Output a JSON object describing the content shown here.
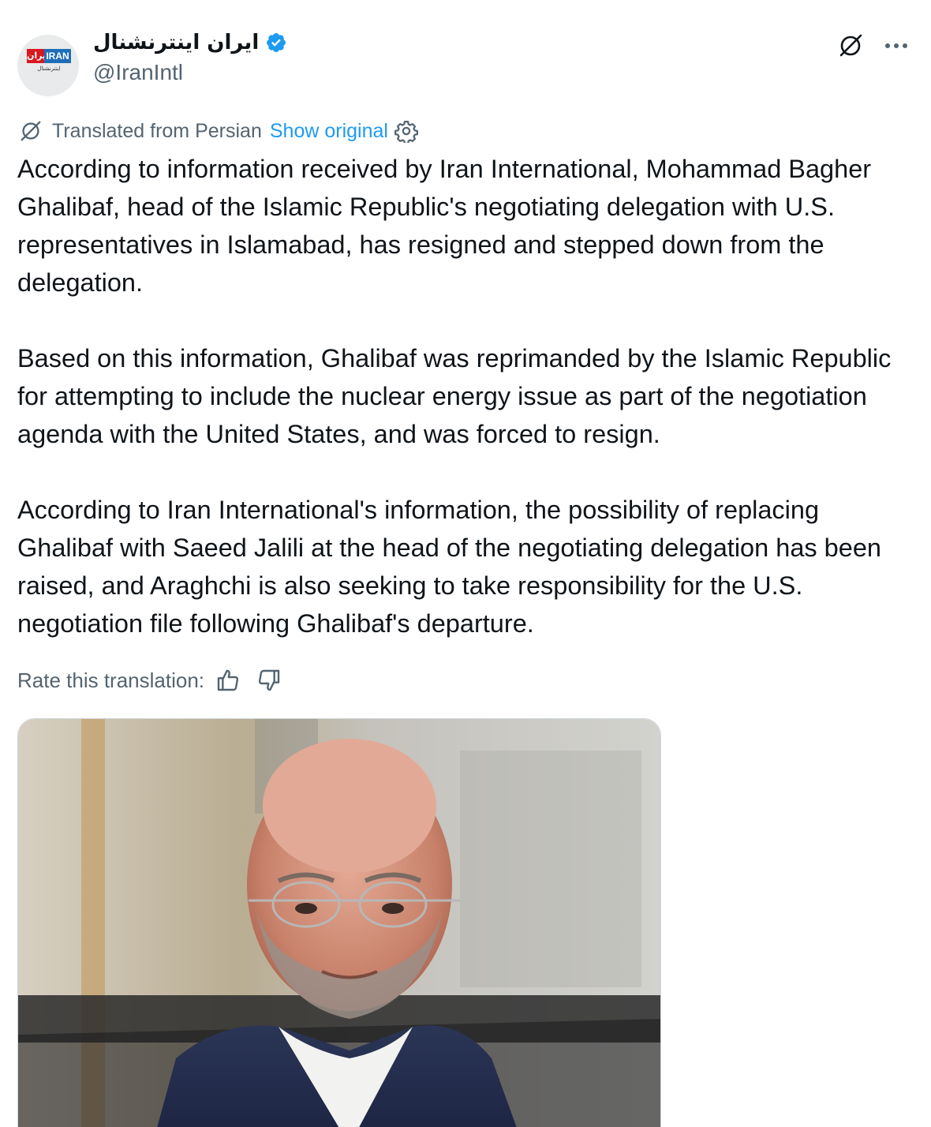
{
  "author": {
    "display_name": "ایران اینترنشنال",
    "handle": "@IranIntl",
    "verified": true,
    "avatar_logo": {
      "red_text": "ایران",
      "blue_text": "IRAN",
      "sub_text": "اینترنشنال"
    }
  },
  "header_icons": [
    "grok-icon",
    "more-icon"
  ],
  "translation": {
    "label": "Translated from Persian",
    "show_original": "Show original",
    "icon": "translate-icon",
    "settings_icon": "gear-icon"
  },
  "tweet": {
    "paragraphs": [
      "According to information received by Iran International, Mohammad Bagher Ghalibaf, head of the Islamic Republic's negotiating delegation with U.S. representatives in Islamabad, has resigned and stepped down from the delegation.",
      "Based on this information, Ghalibaf was reprimanded by the Islamic Republic for attempting to include the nuclear energy issue as part of the negotiation agenda with the United States, and was forced to resign.",
      "According to Iran International's information, the possibility of replacing Ghalibaf with Saeed Jalili at the head of the negotiating delegation has been raised, and Araghchi is also seeking to take responsibility for the U.S. negotiation file following Ghalibaf's departure."
    ]
  },
  "rate": {
    "label": "Rate this translation:",
    "icons": [
      "thumbs-up-icon",
      "thumbs-down-icon"
    ]
  },
  "colors": {
    "text": "#0f1419",
    "secondary": "#536471",
    "link": "#1d9bf0",
    "verified": "#1d9bf0"
  }
}
